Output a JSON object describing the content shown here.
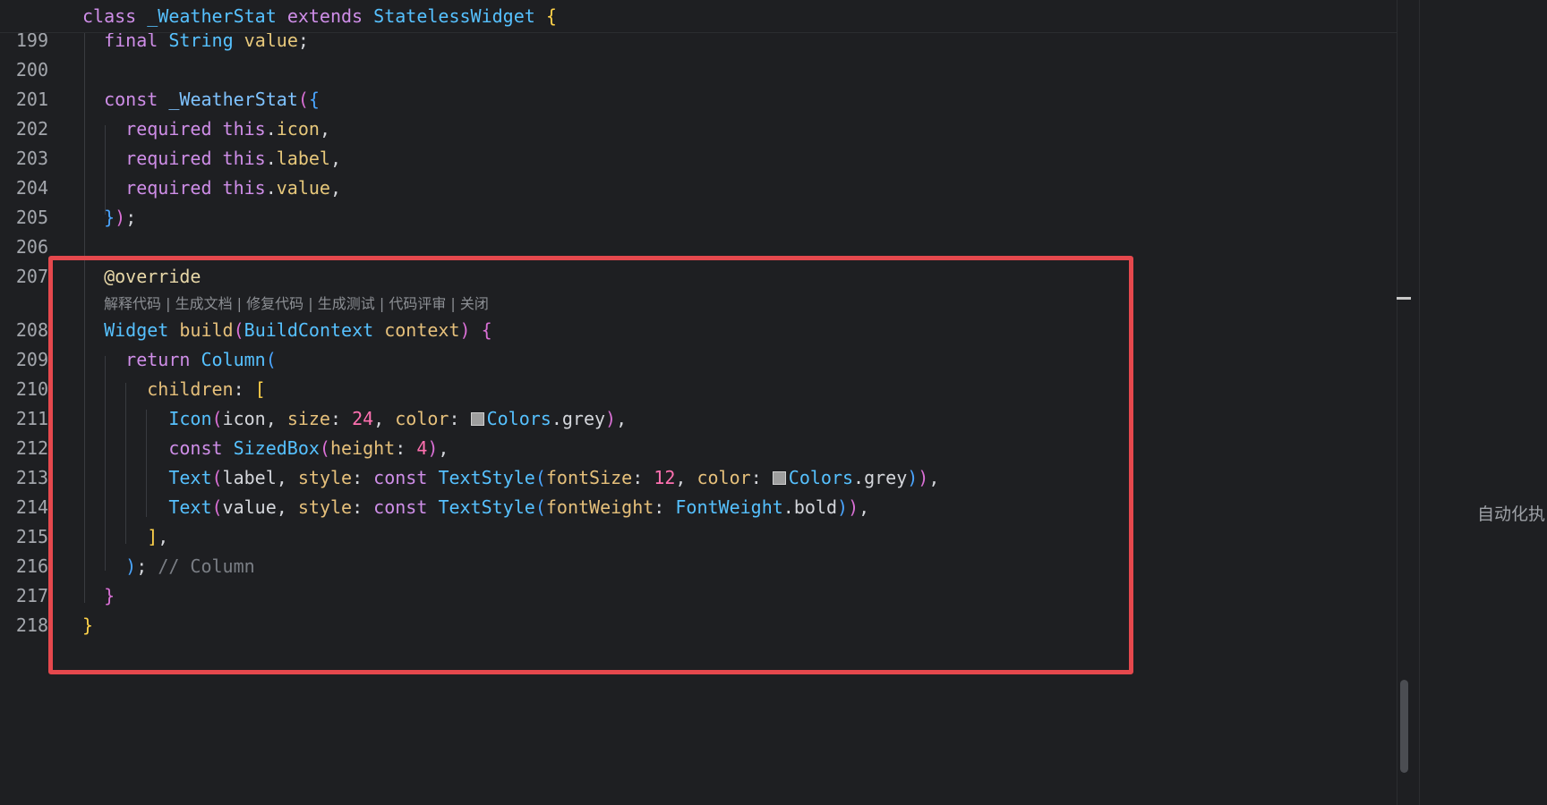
{
  "sticky_header": {
    "kw_class": "class",
    "class_name": "_WeatherStat",
    "kw_extends": "extends",
    "super_type": "StatelessWidget",
    "brace": "{"
  },
  "line_numbers": [
    "199",
    "200",
    "201",
    "202",
    "203",
    "204",
    "205",
    "206",
    "207",
    "208",
    "209",
    "210",
    "211",
    "212",
    "213",
    "214",
    "215",
    "216",
    "217",
    "218"
  ],
  "code": {
    "l199": {
      "kw": "final",
      "type": "String",
      "name": "value",
      "end": ";"
    },
    "l201": {
      "kw": "const",
      "name": "_WeatherStat",
      "open": "(",
      "brace": "{"
    },
    "l202": {
      "kw": "required",
      "this": "this",
      "dot": ".",
      "field": "icon",
      "end": ","
    },
    "l203": {
      "kw": "required",
      "this": "this",
      "dot": ".",
      "field": "label",
      "end": ","
    },
    "l204": {
      "kw": "required",
      "this": "this",
      "dot": ".",
      "field": "value",
      "end": ","
    },
    "l205": {
      "brace": "}",
      "paren": ")",
      "end": ";"
    },
    "l207": {
      "annotation": "@override"
    },
    "l208": {
      "type": "Widget",
      "method": "build",
      "open": "(",
      "param_type": "BuildContext",
      "param": "context",
      "close": ")",
      "brace": "{"
    },
    "l209": {
      "kw": "return",
      "call": "Column",
      "open": "("
    },
    "l210": {
      "named": "children",
      "colon": ": ",
      "bracket": "["
    },
    "l211": {
      "call": "Icon",
      "open": "(",
      "arg": "icon",
      "sep1": ", ",
      "named1": "size",
      "c1": ": ",
      "num": "24",
      "sep2": ", ",
      "named2": "color",
      "c2": ": ",
      "colors": "Colors",
      "dot": ".",
      "grey": "grey",
      "close": ")",
      "end": ","
    },
    "l212": {
      "kw": "const",
      "call": "SizedBox",
      "open": "(",
      "named": "height",
      "c": ": ",
      "num": "4",
      "close": ")",
      "end": ","
    },
    "l213": {
      "call": "Text",
      "open": "(",
      "arg": "label",
      "sep1": ", ",
      "named1": "style",
      "c1": ": ",
      "kw": "const",
      "call2": "TextStyle",
      "open2": "(",
      "named2": "fontSize",
      "c2": ": ",
      "num": "12",
      "sep2": ", ",
      "named3": "color",
      "c3": ": ",
      "colors": "Colors",
      "dot": ".",
      "grey": "grey",
      "close2": ")",
      "close": ")",
      "end": ","
    },
    "l214": {
      "call": "Text",
      "open": "(",
      "arg": "value",
      "sep1": ", ",
      "named1": "style",
      "c1": ": ",
      "kw": "const",
      "call2": "TextStyle",
      "open2": "(",
      "named2": "fontWeight",
      "c2": ": ",
      "fw": "FontWeight",
      "dot": ".",
      "bold": "bold",
      "close2": ")",
      "close": ")",
      "end": ","
    },
    "l215": {
      "bracket": "]",
      "end": ","
    },
    "l216": {
      "paren": ")",
      "end": ";",
      "comment": "// Column"
    },
    "l217": {
      "brace": "}"
    },
    "l218": {
      "brace": "}"
    }
  },
  "code_lens": {
    "explain": "解释代码",
    "gen_doc": "生成文档",
    "fix": "修复代码",
    "gen_test": "生成测试",
    "review": "代码评审",
    "close": "关闭",
    "separator": " | "
  },
  "right_panel": {
    "text": "自动化执"
  },
  "colors": {
    "highlight_border": "#e5484d",
    "editor_bg": "#1e1f22"
  }
}
